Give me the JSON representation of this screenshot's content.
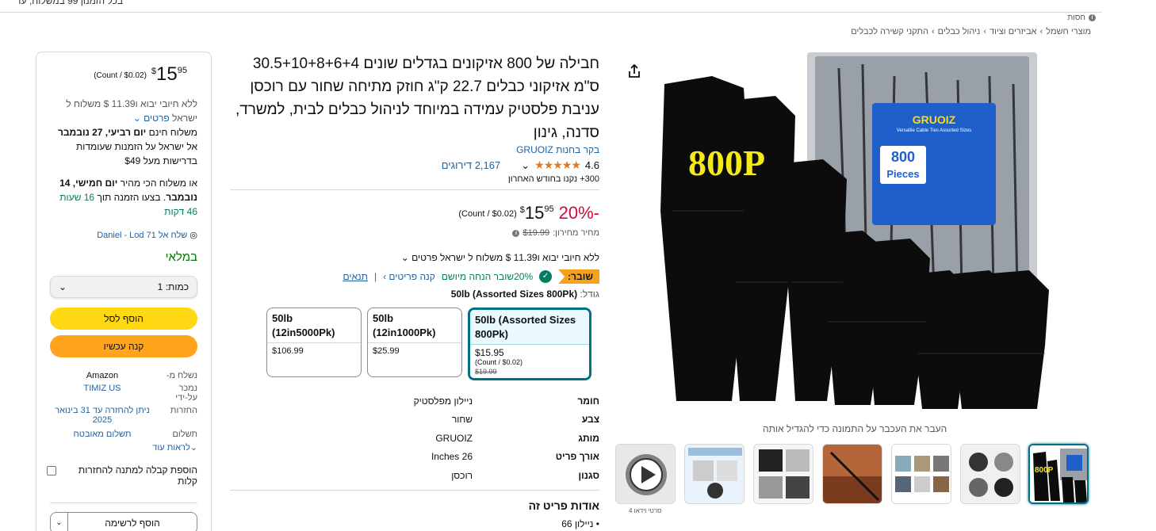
{
  "topbar": {
    "text": "בכל הזמנון 99 במשלוח, עד"
  },
  "sponsored": {
    "label": "חסות"
  },
  "breadcrumb": [
    "מוצרי חשמל",
    "אביזרים וציוד",
    "ניהול כבלים",
    "התקני קשירה לכבלים"
  ],
  "buybox": {
    "price": {
      "currency": "$",
      "whole": "15",
      "fraction": "95",
      "unit": "(Count / $0.02)"
    },
    "import_text": "ללא חיובי יבוא ו11.39 $ משלוח ל ישראל",
    "details_link": "פרטים",
    "free_delivery_pre": "משלוח חינם",
    "free_delivery_date": "יום רביעי, 27 נובמבר",
    "free_delivery_post": "אל ישראל על הזמנות שעומדות בדרישות מעל $49",
    "fast_pre": "או משלוח הכי מהיר",
    "fast_date": "יום חמישי, 14 נובמבר",
    "fast_mid": ". בצעו הזמנה תוך",
    "fast_countdown": "16 שעות 46 דקות",
    "ship_to": "שלח אל Daniel - Lod 71",
    "in_stock": "במלאי",
    "qty_label": "כמות:",
    "qty_value": "1",
    "add_to_cart": "הוסף לסל",
    "buy_now": "קנה עכשיו",
    "seller": [
      {
        "key": "נשלח מ-",
        "value": "Amazon"
      },
      {
        "key": "נמכר על-ידי",
        "value": "TIMIZ US"
      },
      {
        "key": "החזרות",
        "value": "ניתן להחזרה עד 31 בינואר 2025"
      },
      {
        "key": "תשלום",
        "value": "תשלום מאובטח"
      }
    ],
    "see_more": "לראות עוד",
    "gift_receipt": "הוספת קבלה למתנה להחזרות קלות",
    "add_to_list": "הוסף לרשימה"
  },
  "product": {
    "title": "חבילה של 800 אזיקונים בגדלים שונים 30.5+10+8+6+4 ס\"מ אזיקוני כבלים 22.7 ק\"ג חוזק מתיחה שחור עם רוכסן עניבת פלסטיק עמידה במיוחד לניהול כבלים לבית, למשרד, סדנה, גינון",
    "store_link": "בקר בחנות GRUOIZ",
    "rating": "4.6",
    "stars": "★★★★★",
    "reviews": "2,167 דירוגים",
    "bought": "300+ נקנו בחודש האחרון",
    "discount": "-20%",
    "price": {
      "currency": "$",
      "whole": "15",
      "fraction": "95",
      "unit": "(Count / $0.02)"
    },
    "list_price_label": "מחיר מחירון:",
    "list_price": "$19.99",
    "import_text": "ללא חיובי יבוא ו11.39 $ משלוח ל ישראל פרטים",
    "coupon_badge": "שובר:",
    "coupon_text": "20%שובר הנחה מיושם",
    "coupon_shop": "קנה פריטים ›",
    "coupon_terms": "תנאים",
    "size_label": "גודל:",
    "size_selected": "50lb (Assorted Sizes 800Pk)",
    "sizes": [
      {
        "name": "50lb (Assorted Sizes 800Pk)",
        "price": "$15.95",
        "unit": "(Count / $0.02)",
        "list": "$19.99"
      },
      {
        "name": "50lb (12in1000Pk)",
        "price": "$25.99"
      },
      {
        "name": "50lb (12in5000Pk)",
        "price": "$106.99"
      }
    ],
    "specs": [
      {
        "k": "חומר",
        "v": "ניילון מפלסטיק"
      },
      {
        "k": "צבע",
        "v": "שחור"
      },
      {
        "k": "מותג",
        "v": "GRUOIZ"
      },
      {
        "k": "אורך פריט",
        "v": "26 Inches"
      },
      {
        "k": "סגנון",
        "v": "רוכסן"
      }
    ],
    "about_title": "אודות פריט זה",
    "bullet1": "ניילון 66"
  },
  "gallery": {
    "hover_hint": "העבר את העכבר על התמונה כדי להגדיל אותה",
    "box_brand": "GRUOIZ",
    "box_sub": "Versatile Cable Ties Assorted Sizes",
    "box_count": "800",
    "box_count_word": "Pieces",
    "overlay": "800P",
    "video_caption": "4 סרטי וידאו"
  },
  "colors": {
    "accent": "#007185",
    "price_red": "#cc0c39",
    "cart": "#ffd814",
    "buy": "#ffa41c",
    "link": "#2162a1"
  }
}
